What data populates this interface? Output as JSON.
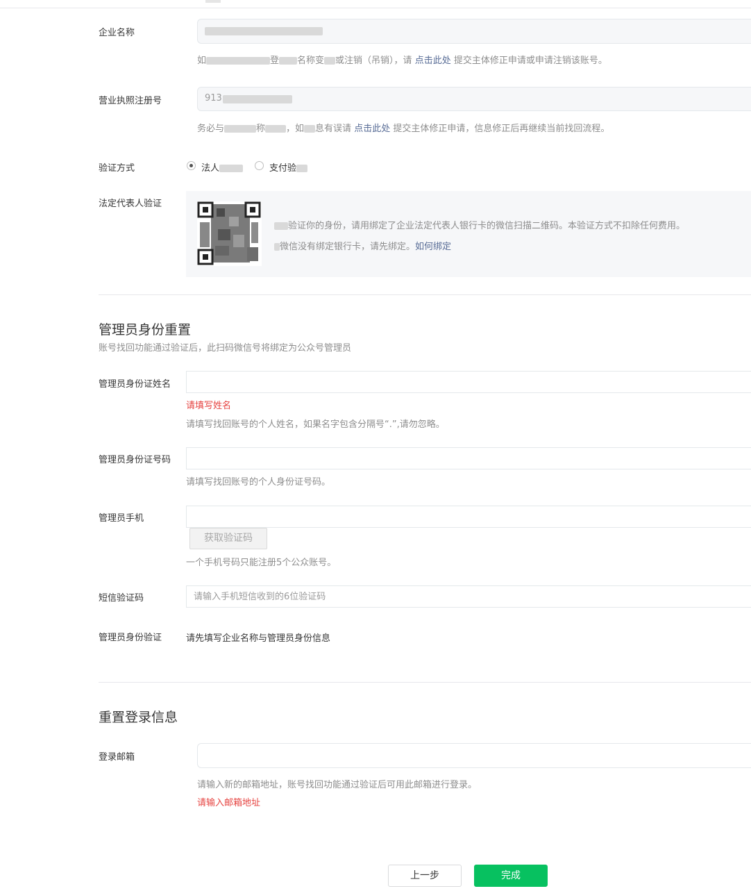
{
  "company": {
    "label": "企业名称",
    "tip_parts": {
      "prefix": "如",
      "a": "登",
      "b": "名称变",
      "c": "或注销（吊销），请",
      "link": "点击此处",
      "suffix": "提交主体修正申请或申请注销该账号。"
    }
  },
  "license": {
    "label": "营业执照注册号",
    "value_prefix": "913",
    "tip_parts": {
      "a": "务必与",
      "b": "称",
      "c": "，如",
      "d": "息有误请",
      "link": "点击此处",
      "suffix": "提交主体修正申请，信息修正后再继续当前找回流程。"
    }
  },
  "verify_method": {
    "label": "验证方式",
    "option1": "法人",
    "option2": "支付验"
  },
  "legal_verify": {
    "label": "法定代表人验证",
    "line1": "验证你的身份，请用绑定了企业法定代表人银行卡的微信扫描二维码。本验证方式不扣除任何费用。",
    "line2": "微信没有绑定银行卡，请先绑定。",
    "line2_link": "如何绑定"
  },
  "admin_reset": {
    "title": "管理员身份重置",
    "subtitle": "账号找回功能通过验证后，此扫码微信号将绑定为公众号管理员",
    "name_label": "管理员身份证姓名",
    "name_error": "请填写姓名",
    "name_tip": "请填写找回账号的个人姓名，如果名字包含分隔号“.”,请勿忽略。",
    "id_label": "管理员身份证号码",
    "id_tip": "请填写找回账号的个人身份证号码。",
    "phone_label": "管理员手机",
    "get_code_button": "获取验证码",
    "phone_tip": "一个手机号码只能注册5个公众账号。",
    "sms_label": "短信验证码",
    "sms_placeholder": "请输入手机短信收到的6位验证码",
    "identity_label": "管理员身份验证",
    "identity_value": "请先填写企业名称与管理员身份信息"
  },
  "login_reset": {
    "title": "重置登录信息",
    "email_label": "登录邮箱",
    "email_tip": "请输入新的邮箱地址，账号找回功能通过验证后可用此邮箱进行登录。",
    "email_error": "请输入邮箱地址"
  },
  "actions": {
    "prev": "上一步",
    "finish": "完成"
  },
  "colors": {
    "primary": "#07c160",
    "link": "#576b95",
    "error": "#e64340"
  }
}
